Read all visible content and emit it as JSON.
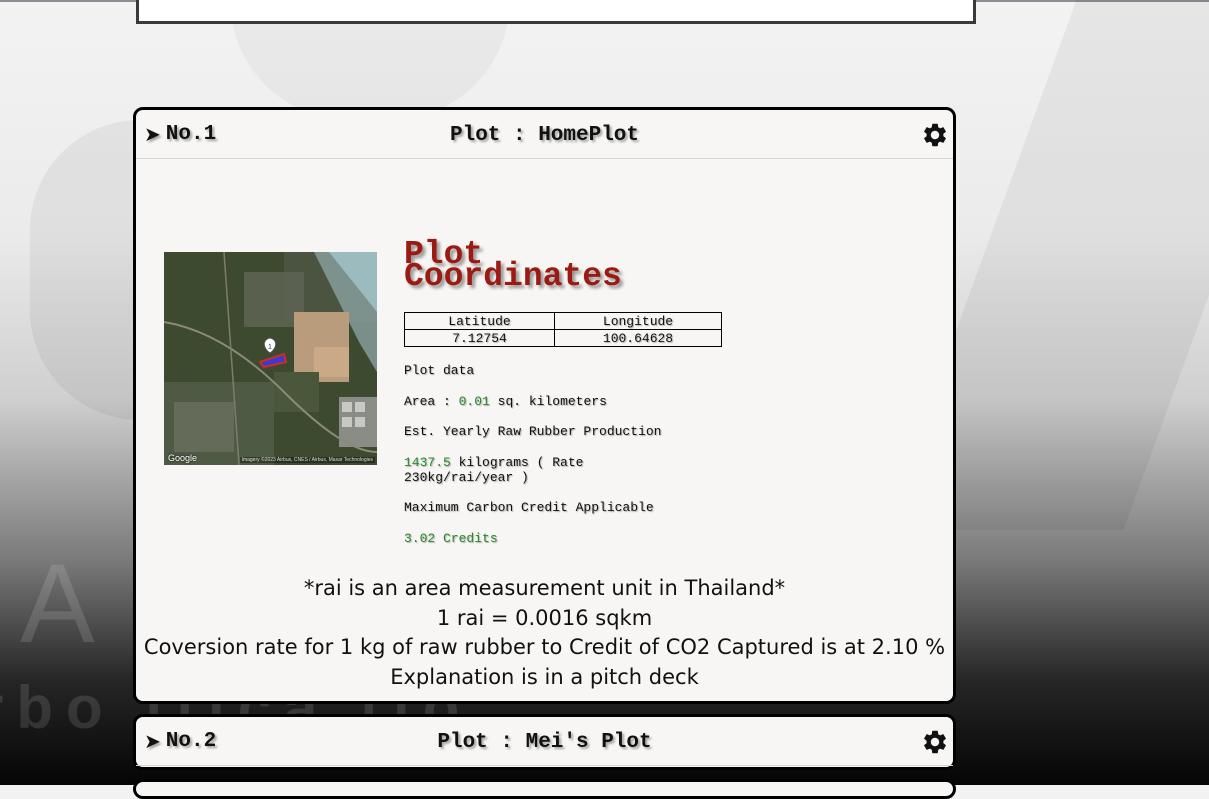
{
  "background": {
    "watermark_big": "A           I O N",
    "watermark_sub": "rbo    ifica tio"
  },
  "plots": [
    {
      "number": "No.1",
      "title": "Plot : HomePlot",
      "map": {
        "attribution_brand": "Google",
        "attribution_imagery": "Imagery ©2023 Airbus, CNES / Airbus, Maxar Technologies",
        "marker_label": "1"
      },
      "coordinates_title": "Plot Coordinates",
      "latitude_header": "Latitude",
      "longitude_header": "Longitude",
      "latitude": "7.12754",
      "longitude": "100.64628",
      "plot_data_label": "Plot data",
      "area_label": "Area :",
      "area_value": "0.01",
      "area_unit": "sq. kilometers",
      "production_label": "Est. Yearly Raw Rubber Production",
      "production_value": "1437.5",
      "production_unit": "kilograms ( Rate 230kg/rai/year )",
      "credit_label": "Maximum Carbon Credit Applicable",
      "credit_value": "3.02 Credits",
      "notes": [
        "*rai is an area measurement unit in Thailand*",
        "1 rai = 0.0016 sqkm",
        "Coversion rate for 1 kg of raw rubber to Credit of CO2 Captured is at 2.10 %",
        "Explanation is in a pitch deck"
      ]
    },
    {
      "number": "No.2",
      "title": "Plot : Mei's Plot"
    }
  ],
  "icons": {
    "expand": "chevron-right-icon",
    "settings": "gear-icon"
  },
  "colors": {
    "heading_red": "#9b1a12",
    "value_green": "#2a8a2a",
    "card_bg": "#f7f6f4"
  }
}
